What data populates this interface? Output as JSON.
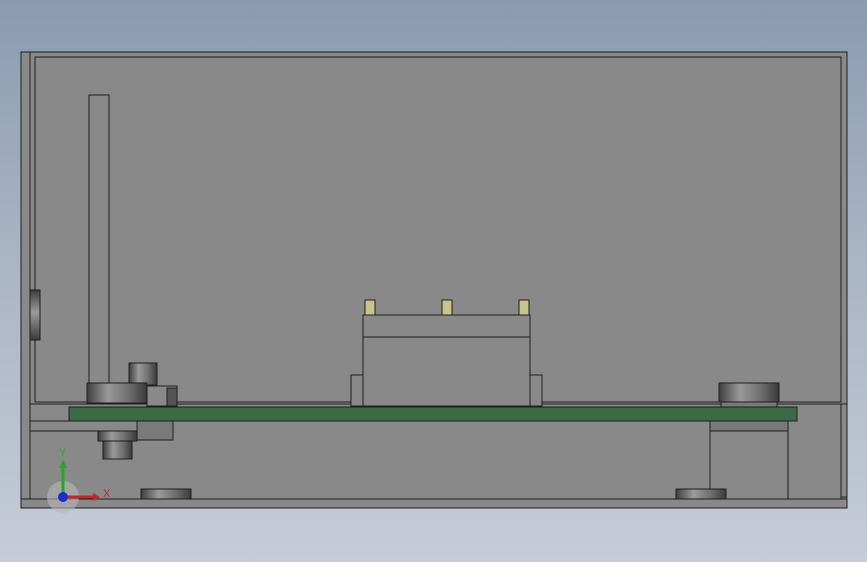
{
  "viewport": {
    "background_top": "#8a9bb0",
    "background_bottom": "#c6ccd8"
  },
  "model": {
    "enclosure_color": "#898989",
    "edge_color": "#1e1e1e",
    "pcb_color": "#3a6b45",
    "pin_color": "#c8c48a",
    "cylinder_dark": "#4a4a4a",
    "cylinder_light": "#8c8c8c"
  },
  "triad": {
    "x_label": "X",
    "y_label": "Y",
    "x_color": "#cc2222",
    "y_color": "#22aa22",
    "z_color": "#1a2fd0"
  }
}
